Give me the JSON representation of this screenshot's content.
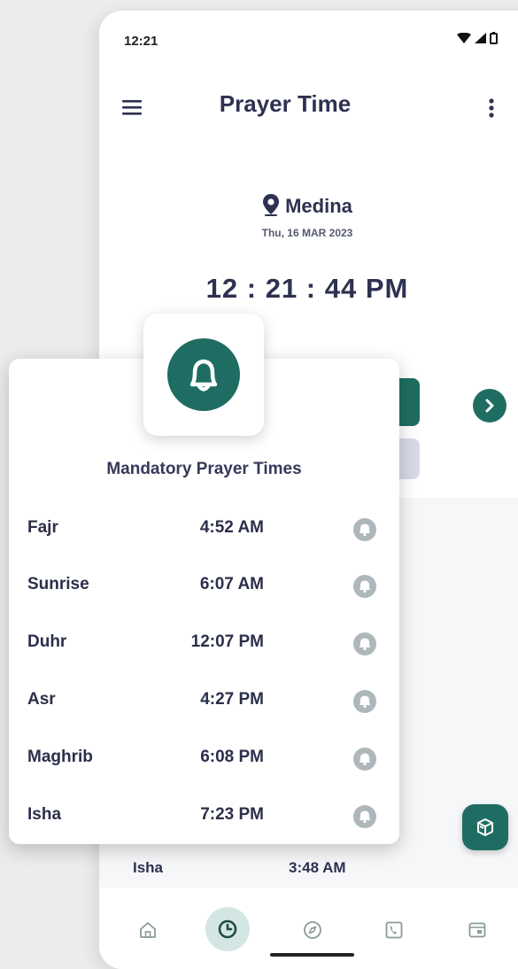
{
  "status_bar": {
    "time": "12:21"
  },
  "app_bar": {
    "title": "Prayer Time"
  },
  "header": {
    "location": "Medina",
    "date": "Thu, 16 MAR 2023",
    "clock": "12 : 21 : 44 PM"
  },
  "background_row": {
    "name": "Isha",
    "time": "3:48 AM"
  },
  "popup": {
    "title": "Mandatory Prayer Times",
    "prayers": [
      {
        "name": "Fajr",
        "time": "4:52 AM"
      },
      {
        "name": "Sunrise",
        "time": "6:07 AM"
      },
      {
        "name": "Duhr",
        "time": "12:07 PM"
      },
      {
        "name": "Asr",
        "time": "4:27 PM"
      },
      {
        "name": "Maghrib",
        "time": "6:08 PM"
      },
      {
        "name": "Isha",
        "time": "7:23 PM"
      }
    ]
  },
  "nav": {
    "items": [
      "home-icon",
      "clock-icon",
      "compass-icon",
      "phone-icon",
      "calendar-icon"
    ],
    "active_index": 1
  },
  "colors": {
    "accent": "#1f6d62",
    "text": "#2b2f4a",
    "muted": "#d9dae8"
  }
}
